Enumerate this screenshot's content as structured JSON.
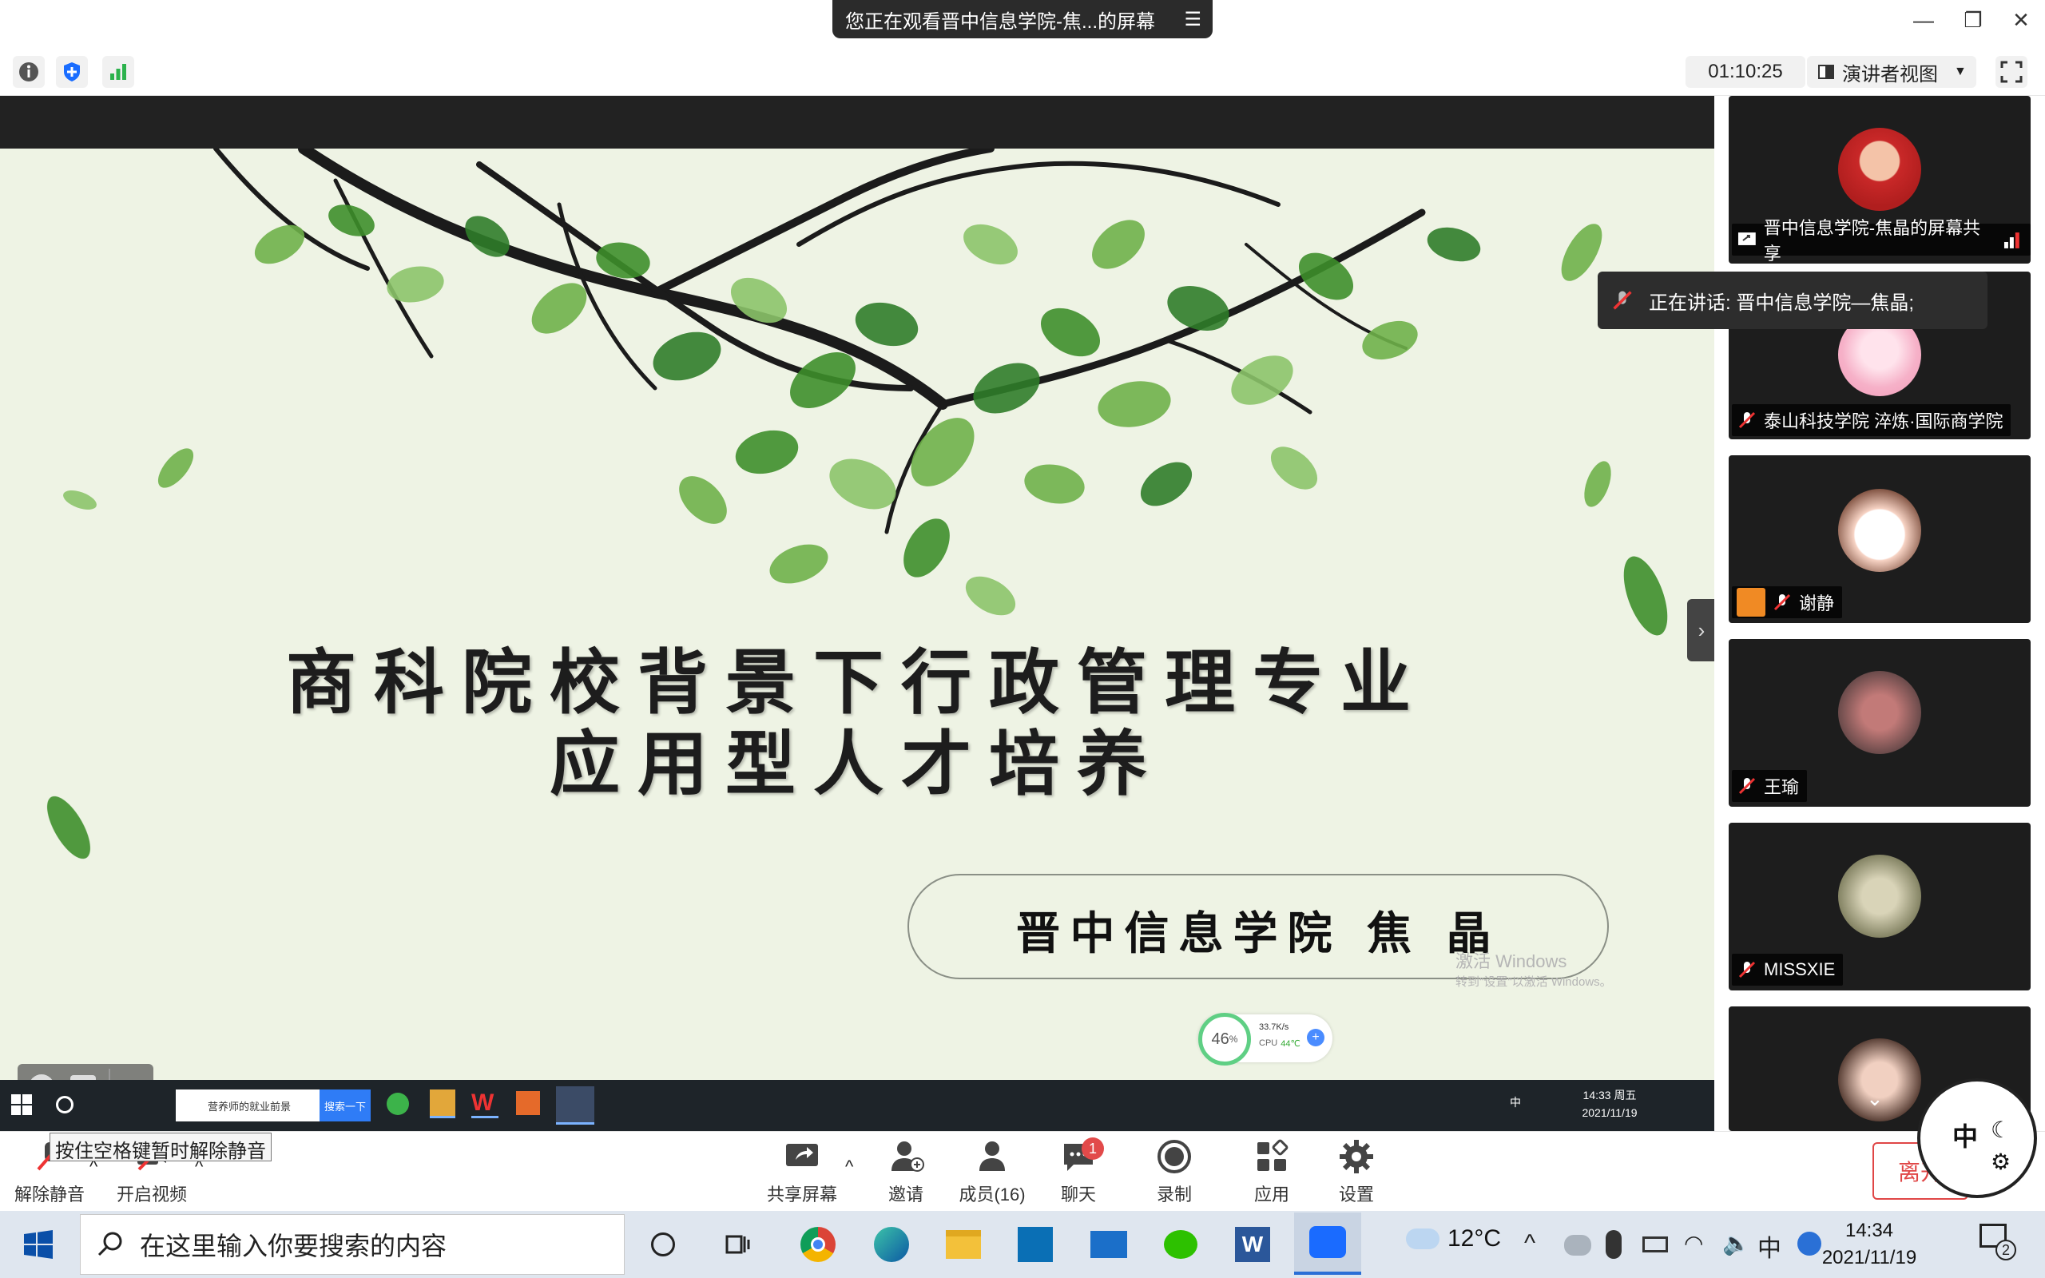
{
  "window": {
    "share_banner": "您正在观看晋中信息学院-焦...的屏幕",
    "minimize": "—",
    "restore": "❐",
    "close": "✕"
  },
  "toolbar": {
    "timer": "01:10:25",
    "view_mode": "演讲者视图"
  },
  "slide": {
    "title_line1": "商科院校背景下行政管理专业",
    "title_line2": "应用型人才培养",
    "author": "晋中信息学院   焦 晶",
    "activate_line1": "激活 Windows",
    "activate_line2": "转到\"设置\"以激活 Windows。",
    "net_percent": "46",
    "net_percent_unit": "%",
    "net_speed": "33.7K/s",
    "cpu_label": "CPU",
    "cpu_temp": "44℃"
  },
  "inner_taskbar": {
    "browser_tab": "营养师的就业前景",
    "search_button": "搜索一下",
    "time": "14:33 周五",
    "date": "2021/11/19",
    "ime": "中"
  },
  "participants": {
    "speaking": "正在讲话: 晋中信息学院—焦晶;",
    "tiles": [
      {
        "name": "晋中信息学院-焦晶的屏幕共享"
      },
      {
        "name": "泰山科技学院   淬炼·国际商学院"
      },
      {
        "name": "谢静"
      },
      {
        "name": "王瑜"
      },
      {
        "name": "MISSXIE"
      }
    ]
  },
  "meeting_bar": {
    "tooltip": "按住空格键暂时解除静音",
    "unmute": "解除静音",
    "start_video": "开启视频",
    "share_screen": "共享屏幕",
    "invite": "邀请",
    "members": "成员(16)",
    "chat": "聊天",
    "chat_badge": "1",
    "record": "录制",
    "apps": "应用",
    "settings": "设置",
    "leave": "离开",
    "ime_widget": "中"
  },
  "taskbar": {
    "search_placeholder": "在这里输入你要搜索的内容",
    "weather": "12°C",
    "ime": "中",
    "time": "14:34",
    "date": "2021/11/19",
    "notifications": "2"
  },
  "colors": {
    "leaf_dark": "#2f7d2a",
    "leaf_light": "#8cc56a",
    "accent_blue": "#0b5cff",
    "leave_red": "#e04646"
  }
}
